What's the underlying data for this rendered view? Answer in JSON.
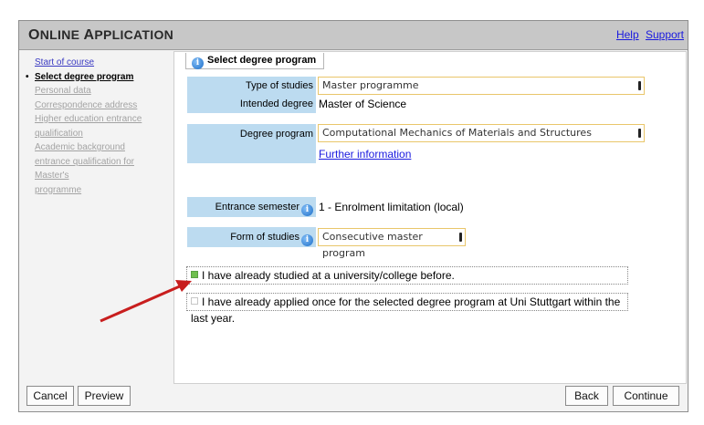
{
  "header": {
    "title_first": "O",
    "title_rest": "NLINE ",
    "title_second_first": "A",
    "title_second_rest": "PPLICATION",
    "links": [
      "Help",
      "Support"
    ]
  },
  "sidebar": {
    "bullet": "•",
    "items": [
      {
        "label": "Start of course",
        "state": "visited"
      },
      {
        "label": "Select degree program",
        "state": "current"
      },
      {
        "label": "Personal data",
        "state": "disabled"
      },
      {
        "label": "Correspondence address",
        "state": "disabled"
      },
      {
        "label": "Higher education entrance",
        "state": "disabled"
      },
      {
        "label": "qualification",
        "state": "disabled"
      },
      {
        "label": "Academic background",
        "state": "disabled"
      },
      {
        "label": "entrance qualification for Master's",
        "state": "disabled"
      },
      {
        "label": "programme",
        "state": "disabled"
      }
    ]
  },
  "tab": {
    "label": "Select degree program",
    "icon": "info-icon"
  },
  "form": {
    "type_label": "Type of studies",
    "type_value": "Master programme",
    "degree_label": "Intended degree",
    "degree_value": "Master of Science",
    "program_label": "Degree program",
    "program_value": "Computational Mechanics of Materials and Structures",
    "further_info": "Further information",
    "semester_label": "Entrance semester",
    "semester_value": "1 - Enrolment limitation (local)",
    "form_label": "Form of studies",
    "form_value": "Consecutive master program"
  },
  "checks": {
    "studied": {
      "label": "I have already studied at a university/college before.",
      "checked": true
    },
    "applied": {
      "label": "I have already applied once for the selected degree program at Uni Stuttgart within the last year.",
      "checked": false
    }
  },
  "footer": {
    "cancel": "Cancel",
    "preview": "Preview",
    "back": "Back",
    "continue": "Continue"
  },
  "colors": {
    "label_bg": "#bcdbf0",
    "select_border": "#e9c66a",
    "link": "#1a1adf",
    "annotation_arrow": "#c81e1e",
    "checked": "#6fbf4e"
  }
}
